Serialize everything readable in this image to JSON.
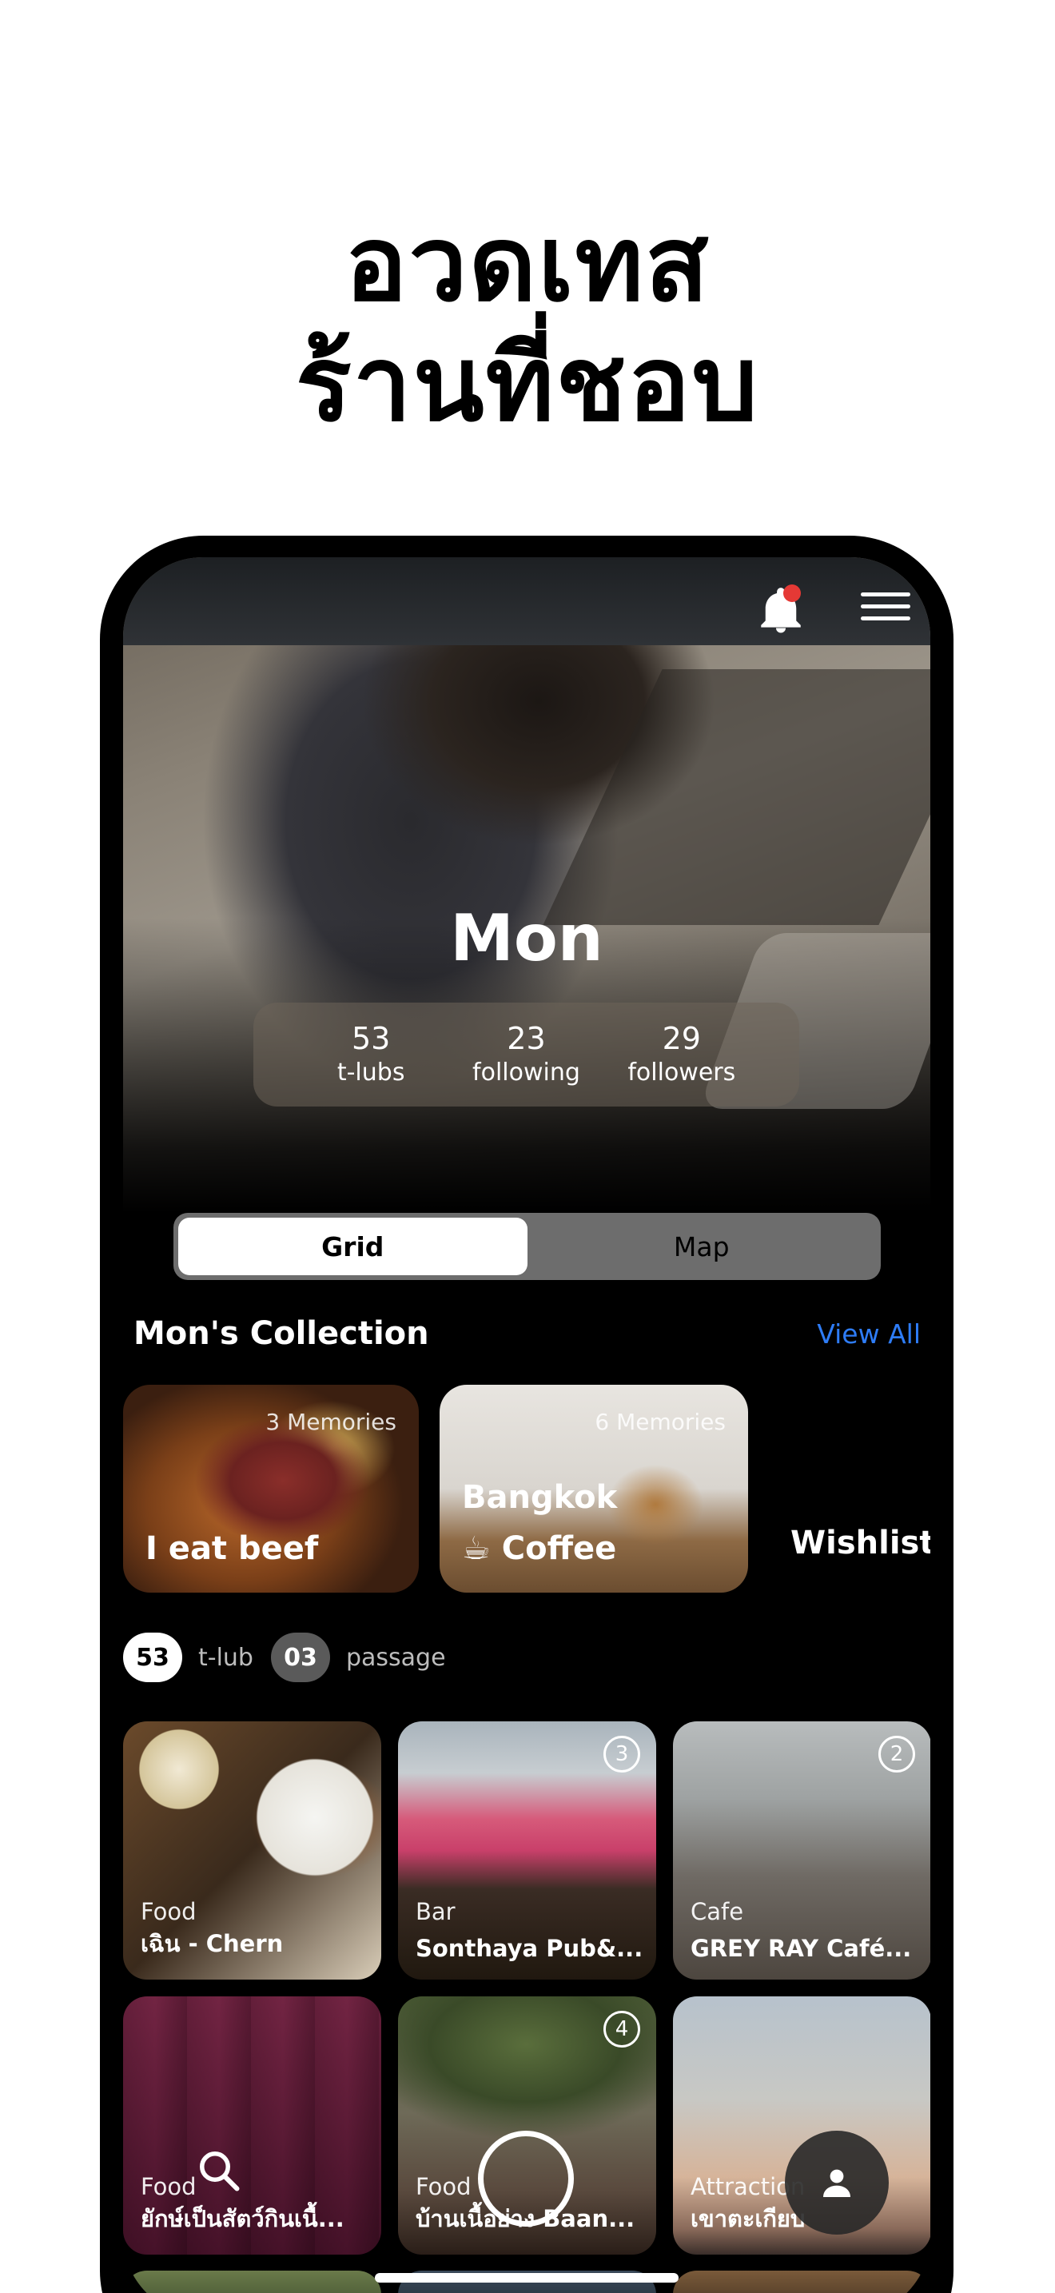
{
  "headline": {
    "line1": "อวดเทส",
    "line2": "ร้านที่ชอบ"
  },
  "profile": {
    "name": "Mon",
    "stats": [
      {
        "value": "53",
        "label": "t-lubs"
      },
      {
        "value": "23",
        "label": "following"
      },
      {
        "value": "29",
        "label": "followers"
      }
    ]
  },
  "segment": {
    "grid_label": "Grid",
    "map_label": "Map",
    "selected": "Grid"
  },
  "collection": {
    "title": "Mon's Collection",
    "view_all": "View All",
    "cards": [
      {
        "memories": "3 Memories",
        "label": "I eat beef"
      },
      {
        "memories": "6 Memories",
        "sub": "Bangkok",
        "label": "☕ Coffee"
      }
    ],
    "wishlist": "Wishlist"
  },
  "counters": {
    "tlub_count": "53",
    "tlub_label": "t-lub",
    "passage_count": "03",
    "passage_label": "passage"
  },
  "grid": [
    {
      "category": "Food",
      "name": "เฉิน - Chern",
      "badge": ""
    },
    {
      "category": "Bar",
      "name": "Sonthaya Pub&...",
      "badge": "3"
    },
    {
      "category": "Cafe",
      "name": "GREY RAY Café...",
      "badge": "2"
    },
    {
      "category": "Food",
      "name": "ยักษ์เป็นสัตว์กินเนื้...",
      "badge": ""
    },
    {
      "category": "Food",
      "name": "บ้านเนื้อย่าง Baan...",
      "badge": "4"
    },
    {
      "category": "Attraction",
      "name": "เขาตะเกียบ",
      "badge": ""
    }
  ],
  "icons": {
    "notification": "bell-icon",
    "menu": "hamburger-menu-icon",
    "search": "search-icon",
    "capture": "capture-circle-icon",
    "profile": "person-icon"
  },
  "colors": {
    "accent": "#2e7cf6",
    "notification_dot": "#e53935",
    "background": "#000000"
  }
}
